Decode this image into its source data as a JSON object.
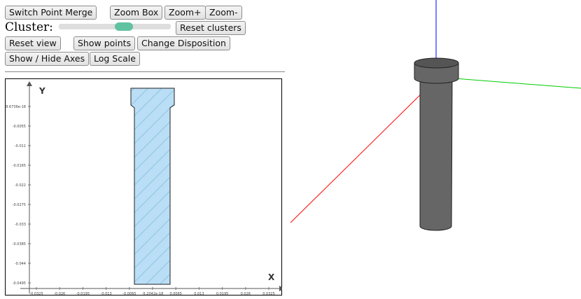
{
  "toolbar": {
    "switch_point_merge": "Switch Point Merge",
    "zoom_box": "Zoom Box",
    "zoom_in": "Zoom+",
    "zoom_out": "Zoom-",
    "cluster_label": "Cluster:",
    "reset_clusters": "Reset clusters",
    "reset_view": "Reset view",
    "show_points": "Show points",
    "change_disposition": "Change Disposition",
    "show_hide_axes": "Show / Hide Axes",
    "log_scale": "Log Scale"
  },
  "cluster_slider": {
    "value_fraction": 0.6
  },
  "plot2d": {
    "x_axis_label": "X",
    "y_axis_label": "Y",
    "x_ticks": [
      "-0.0325",
      "-0.026",
      "-0.0195",
      "-0.013",
      "-0.0065",
      "-5.2042e-18",
      "0.0065",
      "0.013",
      "0.0195",
      "0.026",
      "0.0325"
    ],
    "y_ticks": [
      "8.6736e-18",
      "-0.0055",
      "-0.011",
      "-0.0165",
      "-0.022",
      "-0.0275",
      "-0.033",
      "-0.0385",
      "-0.044",
      "-0.0495"
    ],
    "shape_fill": "#b9def5",
    "shape_hatch": "#8fc3e3"
  },
  "view3d": {
    "x_axis_color": "#ff0000",
    "y_axis_color": "#00cc00",
    "z_axis_color": "#0000ff",
    "body_color": "#666666"
  }
}
